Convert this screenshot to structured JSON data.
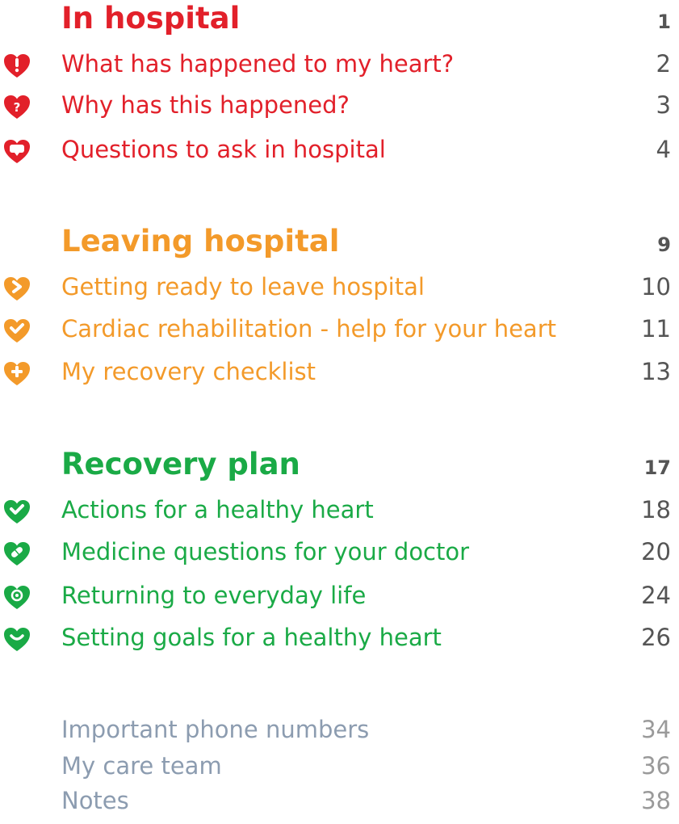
{
  "colors": {
    "red": "#e2202a",
    "orange": "#f39a2a",
    "green": "#1aaa46",
    "grey": "#8c9cb0"
  },
  "sections": [
    {
      "title": "In hospital",
      "page": "1",
      "items": [
        {
          "label": "What has happened to my heart?",
          "page": "2",
          "icon": "heart-exclamation-icon"
        },
        {
          "label": "Why has this happened?",
          "page": "3",
          "icon": "heart-question-icon"
        },
        {
          "label": "Questions to ask in hospital",
          "page": "4",
          "icon": "heart-speech-icon"
        }
      ]
    },
    {
      "title": "Leaving hospital",
      "page": "9",
      "items": [
        {
          "label": "Getting ready to leave hospital",
          "page": "10",
          "icon": "heart-arrow-icon"
        },
        {
          "label": "Cardiac rehabilitation - help for your heart",
          "page": "11",
          "icon": "heart-check-icon"
        },
        {
          "label": "My recovery checklist",
          "page": "13",
          "icon": "heart-plus-icon"
        }
      ]
    },
    {
      "title": "Recovery plan",
      "page": "17",
      "items": [
        {
          "label": "Actions for a healthy heart",
          "page": "18",
          "icon": "heart-check-icon"
        },
        {
          "label": "Medicine questions for your doctor",
          "page": "20",
          "icon": "heart-pill-icon"
        },
        {
          "label": "Returning to everyday life",
          "page": "24",
          "icon": "heart-target-icon"
        },
        {
          "label": "Setting goals for a healthy heart",
          "page": "26",
          "icon": "heart-smile-icon"
        }
      ]
    }
  ],
  "extras": [
    {
      "label": "Important phone numbers",
      "page": "34"
    },
    {
      "label": "My care team",
      "page": "36"
    },
    {
      "label": "Notes",
      "page": "38"
    }
  ]
}
